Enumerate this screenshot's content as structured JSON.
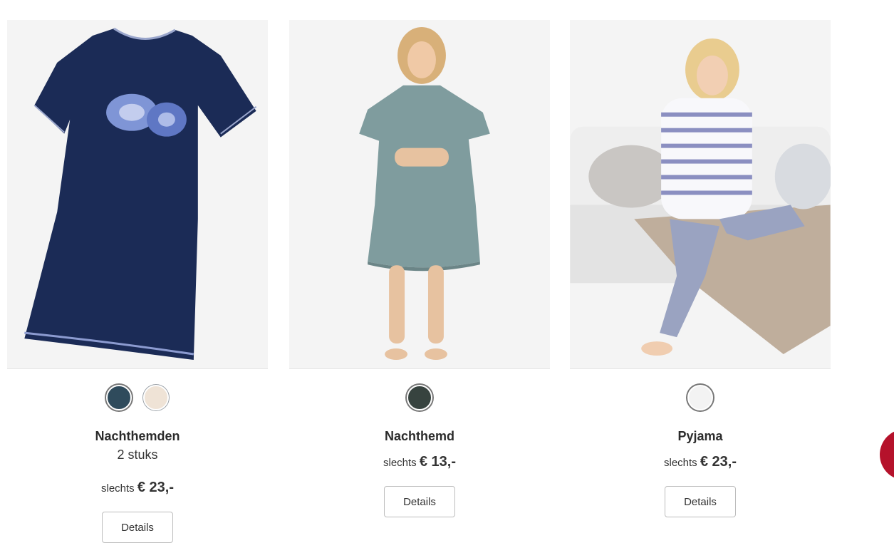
{
  "products": [
    {
      "name": "Nachthemden",
      "subtitle": "2 stuks",
      "price_prefix": "slechts",
      "price": "€ 23,-",
      "button": "Details",
      "swatches": [
        "#2f4b5c",
        "#efe3d6"
      ],
      "image_icon": "nightdress-navy-flower-image"
    },
    {
      "name": "Nachthemd",
      "price_prefix": "slechts",
      "price": "€ 13,-",
      "button": "Details",
      "swatches": [
        "#37433f"
      ],
      "image_icon": "model-paisley-nightdress-image"
    },
    {
      "name": "Pyjama",
      "price_prefix": "slechts",
      "price": "€ 23,-",
      "button": "Details",
      "swatches": [
        "#f3f3f3"
      ],
      "image_icon": "model-striped-pyjama-image"
    }
  ],
  "colors": {
    "chat_button": "#b5122b",
    "image_bg": "#f4f4f4"
  }
}
